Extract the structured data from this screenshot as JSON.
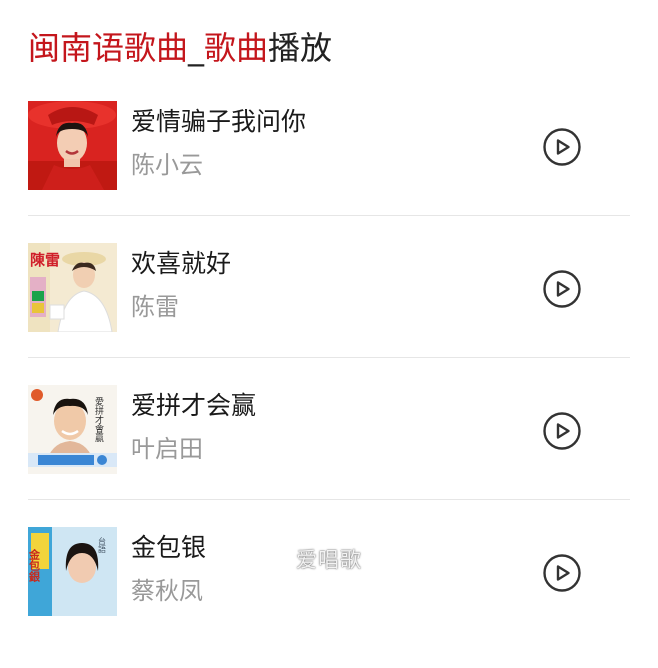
{
  "header": {
    "title_part1": "闽南语歌曲",
    "title_part2": "_",
    "title_part3": "歌曲",
    "title_part4": "播放"
  },
  "songs": [
    {
      "title": "爱情骗子我问你",
      "artist": "陈小云",
      "cover_icon": "album-cover-image"
    },
    {
      "title": "欢喜就好",
      "artist": "陈雷",
      "cover_icon": "album-cover-image",
      "cover_text": "陳雷"
    },
    {
      "title": "爱拼才会赢",
      "artist": "叶启田",
      "cover_icon": "album-cover-image",
      "cover_text": "愛拼才會贏"
    },
    {
      "title": "金包银",
      "artist": "蔡秋凤",
      "cover_icon": "album-cover-image",
      "cover_text": "金包銀"
    }
  ],
  "play_icon": "play-circle-icon",
  "watermark": "爱唱歌",
  "colors": {
    "accent_red": "#c4161c",
    "text_dark": "#222222",
    "text_muted": "#999999",
    "divider": "#e6e6e6",
    "play_icon": "#333333"
  }
}
